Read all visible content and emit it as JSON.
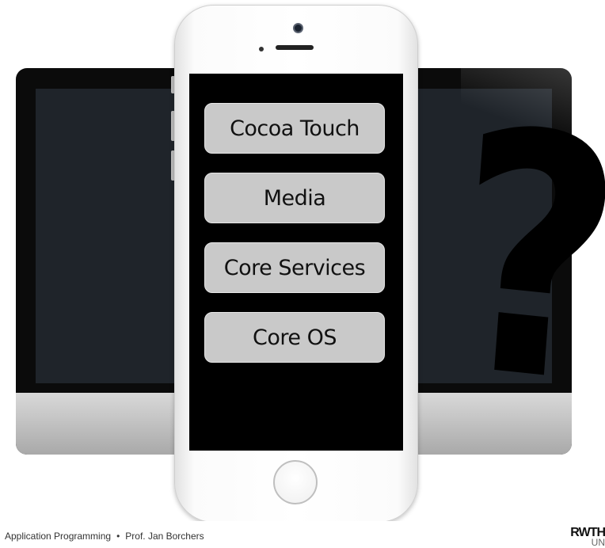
{
  "stack_layers": [
    {
      "label": "Cocoa Touch"
    },
    {
      "label": "Media"
    },
    {
      "label": "Core Services"
    },
    {
      "label": "Core OS"
    }
  ],
  "question_mark": "?",
  "footer": {
    "course": "Application Programming",
    "separator": "•",
    "author": "Prof. Jan Borchers"
  },
  "logo": {
    "text": "RWTH",
    "subtext": "UN"
  },
  "icons": [
    "camera-icon",
    "speaker-icon",
    "home-button-icon"
  ],
  "colors": {
    "layer_fill": "#c9c9c9",
    "phone_screen": "#000000",
    "monitor_bezel": "#0b0b0b"
  }
}
